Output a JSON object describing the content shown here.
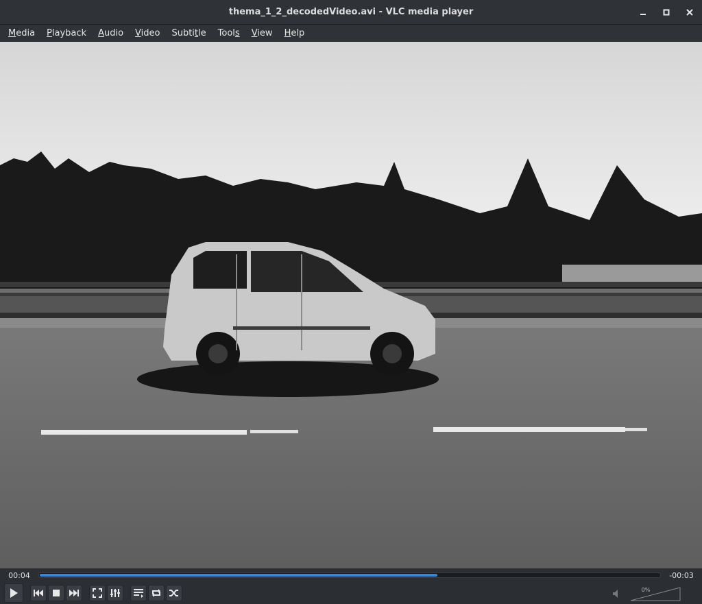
{
  "window": {
    "title": "thema_1_2_decodedVideo.avi - VLC media player"
  },
  "menu": [
    {
      "pre": "",
      "key": "M",
      "post": "edia"
    },
    {
      "pre": "",
      "key": "P",
      "post": "layback"
    },
    {
      "pre": "",
      "key": "A",
      "post": "udio"
    },
    {
      "pre": "",
      "key": "V",
      "post": "ideo"
    },
    {
      "pre": "Subti",
      "key": "t",
      "post": "le"
    },
    {
      "pre": "Tool",
      "key": "s",
      "post": ""
    },
    {
      "pre": "",
      "key": "V",
      "post": "iew"
    },
    {
      "pre": "",
      "key": "H",
      "post": "elp"
    }
  ],
  "player": {
    "elapsed": "00:04",
    "remaining": "-00:03",
    "progress": 0.64,
    "volume_label": "0%"
  },
  "icons": {
    "play": "play-icon",
    "prev": "previous-icon",
    "stop": "stop-icon",
    "next": "next-icon",
    "fullscreen": "fullscreen-icon",
    "extended": "equalizer-icon",
    "playlist": "playlist-icon",
    "loop": "loop-icon",
    "shuffle": "shuffle-icon",
    "volume": "speaker-muted-icon"
  },
  "colors": {
    "accent": "#3a86d6",
    "chrome": "#2f3237"
  }
}
